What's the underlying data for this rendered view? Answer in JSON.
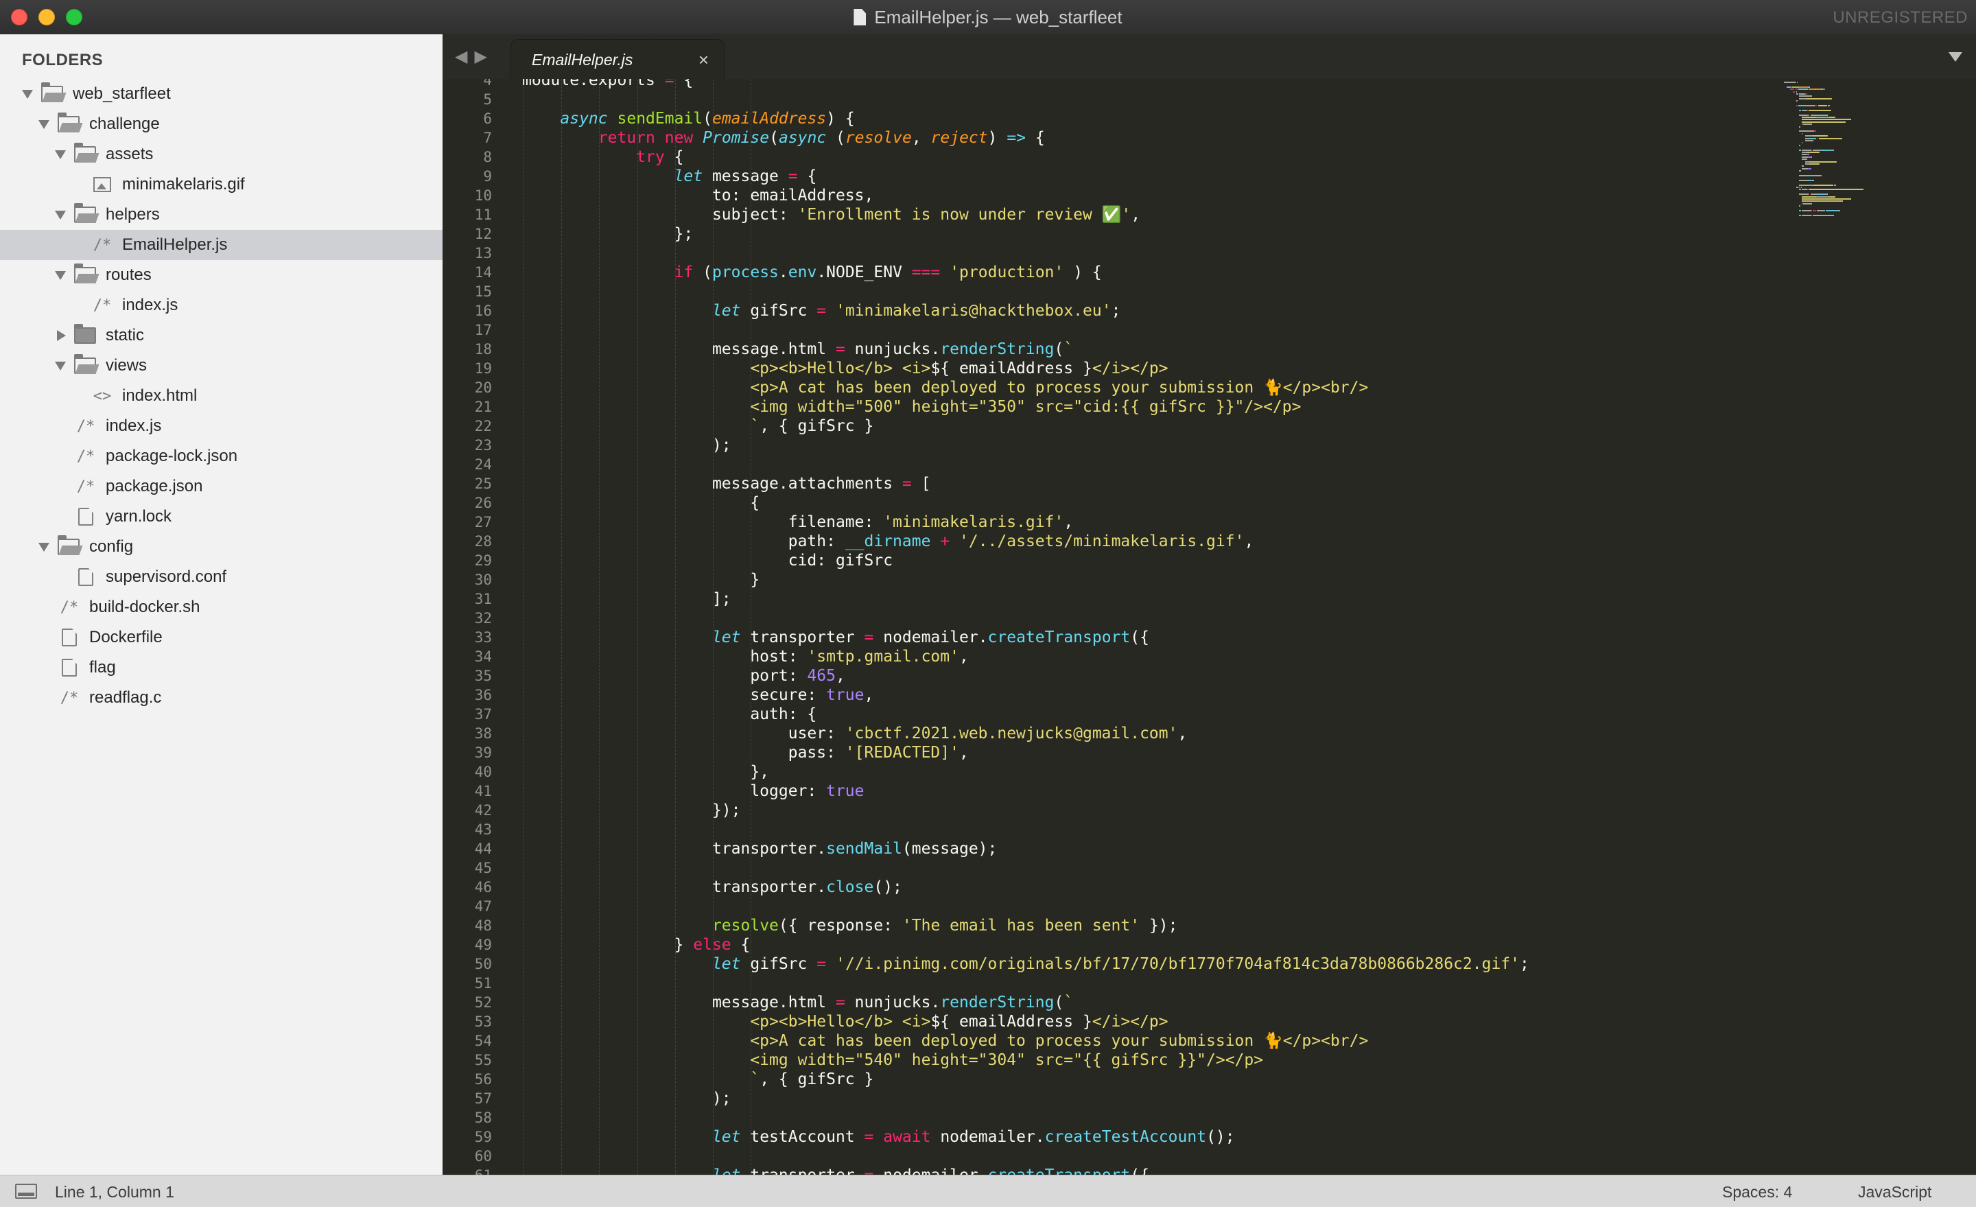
{
  "window": {
    "title": "EmailHelper.js — web_starfleet",
    "badge": "UNREGISTERED"
  },
  "sidebar": {
    "header": "FOLDERS",
    "tree": [
      {
        "label": "web_starfleet",
        "type": "folder",
        "state": "open",
        "depth": 0
      },
      {
        "label": "challenge",
        "type": "folder",
        "state": "open",
        "depth": 1
      },
      {
        "label": "assets",
        "type": "folder",
        "state": "open",
        "depth": 2
      },
      {
        "label": "minimakelaris.gif",
        "type": "image",
        "depth": 3
      },
      {
        "label": "helpers",
        "type": "folder",
        "state": "open",
        "depth": 2
      },
      {
        "label": "EmailHelper.js",
        "type": "code",
        "depth": 3,
        "selected": true
      },
      {
        "label": "routes",
        "type": "folder",
        "state": "open",
        "depth": 2
      },
      {
        "label": "index.js",
        "type": "code",
        "depth": 3
      },
      {
        "label": "static",
        "type": "folder",
        "state": "closed",
        "depth": 2
      },
      {
        "label": "views",
        "type": "folder",
        "state": "open",
        "depth": 2
      },
      {
        "label": "index.html",
        "type": "markup",
        "depth": 3
      },
      {
        "label": "index.js",
        "type": "code",
        "depth": 2
      },
      {
        "label": "package-lock.json",
        "type": "code",
        "depth": 2
      },
      {
        "label": "package.json",
        "type": "code",
        "depth": 2
      },
      {
        "label": "yarn.lock",
        "type": "file",
        "depth": 2
      },
      {
        "label": "config",
        "type": "folder",
        "state": "open",
        "depth": 1
      },
      {
        "label": "supervisord.conf",
        "type": "file",
        "depth": 2
      },
      {
        "label": "build-docker.sh",
        "type": "code",
        "depth": 1
      },
      {
        "label": "Dockerfile",
        "type": "file",
        "depth": 1
      },
      {
        "label": "flag",
        "type": "file",
        "depth": 1
      },
      {
        "label": "readflag.c",
        "type": "code",
        "depth": 1
      }
    ]
  },
  "tabs": [
    {
      "label": "EmailHelper.js",
      "active": true,
      "close_icon": "×"
    }
  ],
  "editor": {
    "first_line_number": 4,
    "lines": [
      [
        {
          "t": "module.exports ",
          "c": "ent"
        },
        {
          "t": "=",
          "c": "kw"
        },
        {
          "t": " {",
          "c": "ent"
        }
      ],
      [],
      [
        {
          "t": "    "
        },
        {
          "t": "async",
          "c": "st"
        },
        {
          "t": " "
        },
        {
          "t": "sendEmail",
          "c": "fn"
        },
        {
          "t": "("
        },
        {
          "t": "emailAddress",
          "c": "pa"
        },
        {
          "t": ") {"
        }
      ],
      [
        {
          "t": "        "
        },
        {
          "t": "return",
          "c": "kw"
        },
        {
          "t": " "
        },
        {
          "t": "new",
          "c": "kw"
        },
        {
          "t": " "
        },
        {
          "t": "Promise",
          "c": "cls"
        },
        {
          "t": "("
        },
        {
          "t": "async",
          "c": "st"
        },
        {
          "t": " ("
        },
        {
          "t": "resolve",
          "c": "pa"
        },
        {
          "t": ", "
        },
        {
          "t": "reject",
          "c": "pa"
        },
        {
          "t": ") "
        },
        {
          "t": "=>",
          "c": "st"
        },
        {
          "t": " {"
        }
      ],
      [
        {
          "t": "            "
        },
        {
          "t": "try",
          "c": "kw"
        },
        {
          "t": " {"
        }
      ],
      [
        {
          "t": "                "
        },
        {
          "t": "let",
          "c": "st"
        },
        {
          "t": " message "
        },
        {
          "t": "=",
          "c": "kw"
        },
        {
          "t": " {"
        }
      ],
      [
        {
          "t": "                    to: emailAddress,"
        }
      ],
      [
        {
          "t": "                    subject: "
        },
        {
          "t": "'Enrollment is now under review ✅'",
          "c": "str"
        },
        {
          "t": ","
        }
      ],
      [
        {
          "t": "                };"
        }
      ],
      [],
      [
        {
          "t": "                "
        },
        {
          "t": "if",
          "c": "kw"
        },
        {
          "t": " ("
        },
        {
          "t": "process",
          "c": "sup"
        },
        {
          "t": "."
        },
        {
          "t": "env",
          "c": "sup"
        },
        {
          "t": ".NODE_ENV "
        },
        {
          "t": "===",
          "c": "kw"
        },
        {
          "t": " "
        },
        {
          "t": "'production'",
          "c": "str"
        },
        {
          "t": " ) {"
        }
      ],
      [],
      [
        {
          "t": "                    "
        },
        {
          "t": "let",
          "c": "st"
        },
        {
          "t": " gifSrc "
        },
        {
          "t": "=",
          "c": "kw"
        },
        {
          "t": " "
        },
        {
          "t": "'minimakelaris@hackthebox.eu'",
          "c": "str"
        },
        {
          "t": ";"
        }
      ],
      [],
      [
        {
          "t": "                    message.html "
        },
        {
          "t": "=",
          "c": "kw"
        },
        {
          "t": " nunjucks."
        },
        {
          "t": "renderString",
          "c": "sup"
        },
        {
          "t": "("
        },
        {
          "t": "`",
          "c": "str"
        }
      ],
      [
        {
          "t": "                        <p><b>Hello</b> <i>",
          "c": "str"
        },
        {
          "t": "${ emailAddress }"
        },
        {
          "t": "</i></p>",
          "c": "str"
        }
      ],
      [
        {
          "t": "                        <p>A cat has been deployed to process your submission 🐈</p><br/>",
          "c": "str"
        }
      ],
      [
        {
          "t": "                        <img width=\"500\" height=\"350\" src=\"cid:{{ gifSrc }}\"/></p>",
          "c": "str"
        }
      ],
      [
        {
          "t": "                        `",
          "c": "str"
        },
        {
          "t": ", { gifSrc }"
        }
      ],
      [
        {
          "t": "                    );"
        }
      ],
      [],
      [
        {
          "t": "                    message.attachments "
        },
        {
          "t": "=",
          "c": "kw"
        },
        {
          "t": " ["
        }
      ],
      [
        {
          "t": "                        {"
        }
      ],
      [
        {
          "t": "                            filename: "
        },
        {
          "t": "'minimakelaris.gif'",
          "c": "str"
        },
        {
          "t": ","
        }
      ],
      [
        {
          "t": "                            path: "
        },
        {
          "t": "__dirname",
          "c": "sup"
        },
        {
          "t": " "
        },
        {
          "t": "+",
          "c": "kw"
        },
        {
          "t": " "
        },
        {
          "t": "'/../assets/minimakelaris.gif'",
          "c": "str"
        },
        {
          "t": ","
        }
      ],
      [
        {
          "t": "                            cid: gifSrc"
        }
      ],
      [
        {
          "t": "                        }"
        }
      ],
      [
        {
          "t": "                    ];"
        }
      ],
      [],
      [
        {
          "t": "                    "
        },
        {
          "t": "let",
          "c": "st"
        },
        {
          "t": " transporter "
        },
        {
          "t": "=",
          "c": "kw"
        },
        {
          "t": " nodemailer."
        },
        {
          "t": "createTransport",
          "c": "sup"
        },
        {
          "t": "({"
        }
      ],
      [
        {
          "t": "                        host: "
        },
        {
          "t": "'smtp.gmail.com'",
          "c": "str"
        },
        {
          "t": ","
        }
      ],
      [
        {
          "t": "                        port: "
        },
        {
          "t": "465",
          "c": "num"
        },
        {
          "t": ","
        }
      ],
      [
        {
          "t": "                        secure: "
        },
        {
          "t": "true",
          "c": "con"
        },
        {
          "t": ","
        }
      ],
      [
        {
          "t": "                        auth: {"
        }
      ],
      [
        {
          "t": "                            user: "
        },
        {
          "t": "'cbctf.2021.web.newjucks@gmail.com'",
          "c": "str"
        },
        {
          "t": ","
        }
      ],
      [
        {
          "t": "                            pass: "
        },
        {
          "t": "'[REDACTED]'",
          "c": "str"
        },
        {
          "t": ","
        }
      ],
      [
        {
          "t": "                        },"
        }
      ],
      [
        {
          "t": "                        logger: "
        },
        {
          "t": "true",
          "c": "con"
        }
      ],
      [
        {
          "t": "                    });"
        }
      ],
      [],
      [
        {
          "t": "                    transporter."
        },
        {
          "t": "sendMail",
          "c": "sup"
        },
        {
          "t": "(message);"
        }
      ],
      [],
      [
        {
          "t": "                    transporter."
        },
        {
          "t": "close",
          "c": "sup"
        },
        {
          "t": "();"
        }
      ],
      [],
      [
        {
          "t": "                    "
        },
        {
          "t": "resolve",
          "c": "fn"
        },
        {
          "t": "({ response: "
        },
        {
          "t": "'The email has been sent'",
          "c": "str"
        },
        {
          "t": " });"
        }
      ],
      [
        {
          "t": "                } "
        },
        {
          "t": "else",
          "c": "kw"
        },
        {
          "t": " {"
        }
      ],
      [
        {
          "t": "                    "
        },
        {
          "t": "let",
          "c": "st"
        },
        {
          "t": " gifSrc "
        },
        {
          "t": "=",
          "c": "kw"
        },
        {
          "t": " "
        },
        {
          "t": "'//i.pinimg.com/originals/bf/17/70/bf1770f704af814c3da78b0866b286c2.gif'",
          "c": "str"
        },
        {
          "t": ";"
        }
      ],
      [],
      [
        {
          "t": "                    message.html "
        },
        {
          "t": "=",
          "c": "kw"
        },
        {
          "t": " nunjucks."
        },
        {
          "t": "renderString",
          "c": "sup"
        },
        {
          "t": "("
        },
        {
          "t": "`",
          "c": "str"
        }
      ],
      [
        {
          "t": "                        <p><b>Hello</b> <i>",
          "c": "str"
        },
        {
          "t": "${ emailAddress }"
        },
        {
          "t": "</i></p>",
          "c": "str"
        }
      ],
      [
        {
          "t": "                        <p>A cat has been deployed to process your submission 🐈</p><br/>",
          "c": "str"
        }
      ],
      [
        {
          "t": "                        <img width=\"540\" height=\"304\" src=\"{{ gifSrc }}\"/></p>",
          "c": "str"
        }
      ],
      [
        {
          "t": "                        `",
          "c": "str"
        },
        {
          "t": ", { gifSrc }"
        }
      ],
      [
        {
          "t": "                    );"
        }
      ],
      [],
      [
        {
          "t": "                    "
        },
        {
          "t": "let",
          "c": "st"
        },
        {
          "t": " testAccount "
        },
        {
          "t": "=",
          "c": "kw"
        },
        {
          "t": " "
        },
        {
          "t": "await",
          "c": "kw"
        },
        {
          "t": " nodemailer."
        },
        {
          "t": "createTestAccount",
          "c": "sup"
        },
        {
          "t": "();"
        }
      ],
      [],
      [
        {
          "t": "                    "
        },
        {
          "t": "let",
          "c": "st"
        },
        {
          "t": " transporter "
        },
        {
          "t": "=",
          "c": "kw"
        },
        {
          "t": " nodemailer."
        },
        {
          "t": "createTransport",
          "c": "sup"
        },
        {
          "t": "({"
        }
      ]
    ]
  },
  "statusbar": {
    "position": "Line 1, Column 1",
    "indentation": "Spaces: 4",
    "syntax": "JavaScript"
  },
  "colors": {
    "editor_bg": "#272822",
    "keyword": "#f92672",
    "storage": "#66d9ef",
    "function": "#a6e22e",
    "parameter": "#fd971f",
    "string": "#e6db74",
    "constant": "#ae81ff",
    "sidebar_bg": "#f2f2f2",
    "sidebar_selected": "#cfd0d3"
  }
}
